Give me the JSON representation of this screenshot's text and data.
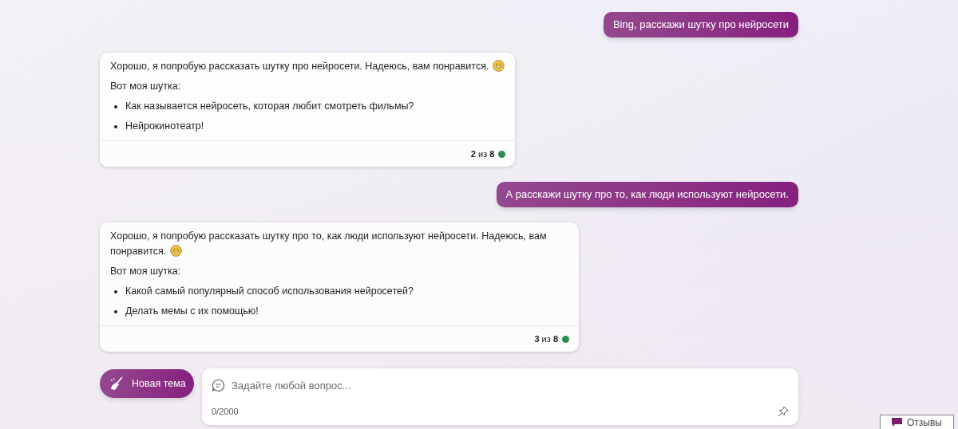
{
  "messages": [
    {
      "kind": "user",
      "text": "Bing, расскажи шутку про нейросети"
    },
    {
      "kind": "bot",
      "text": "Хорошо, я попробую рассказать шутку про нейросети. Надеюсь, вам понравится.",
      "emoji": true,
      "lead": "Вот моя шутка:",
      "bullets": [
        "Как называется нейросеть, которая любит смотреть фильмы?",
        "Нейрокинотеатр!"
      ],
      "counter": "**2** из **8**",
      "color": "#2e8b4f"
    },
    {
      "kind": "user",
      "text": "А расскажи шутку про то, как люди используют нейросети."
    },
    {
      "kind": "bot",
      "text": "Хорошо, я попробую рассказать шутку про то, как люди используют нейросети. Надеюсь, вам понравится.",
      "emoji": true,
      "lead": "Вот моя шутка:",
      "bullets": [
        "Какой самый популярный способ использования нейросетей?",
        "Делать мемы с их помощью!"
      ],
      "counter": "**3** из **8**",
      "color": "#2e8b4f"
    }
  ],
  "composer": {
    "new_topic": "Новая тема",
    "input": {
      "placeholder": "Задайте любой вопрос...",
      "counter": "0/2000"
    }
  },
  "feedback": "Отзывы"
}
